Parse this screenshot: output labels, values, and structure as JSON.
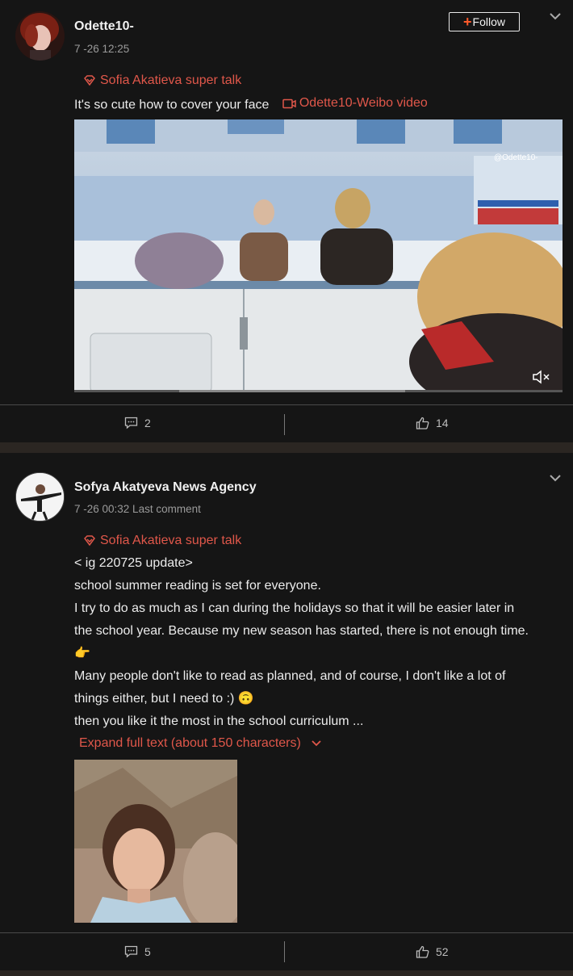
{
  "posts": [
    {
      "username": "Odette10-",
      "time": "7 -26 12:25",
      "follow_label": "Follow",
      "topic": "Sofia Akatieva super talk",
      "text": "It's so cute how to cover your face",
      "video_link": "Odette10-Weibo video",
      "video_watermark": "@Odette10-",
      "comments": "2",
      "likes": "14"
    },
    {
      "username": "Sofya Akatyeva News Agency",
      "time": "7 -26 00:32 Last comment",
      "topic": "Sofia Akatieva super talk",
      "lines": [
        "< ig 220725 update>",
        "school summer reading is set for everyone.",
        "I try to do as much as I can during the holidays so that it will be easier later in",
        "the school year. Because my new season has started, there is not enough time.",
        "👉",
        "Many people don't like to read as planned, and of course, I don't like a lot of",
        "things either, but I need to :) 🙃",
        "then you like it the most in the school curriculum ..."
      ],
      "expand_text": "Expand full text (about 150 characters)",
      "comments": "5",
      "likes": "52"
    }
  ],
  "colors": {
    "accent": "#e0574a",
    "background": "#151515",
    "separator": "#2b2622"
  },
  "icons": [
    "chevron-down-icon",
    "super-topic-icon",
    "video-icon",
    "mute-icon",
    "comment-icon",
    "like-icon"
  ]
}
